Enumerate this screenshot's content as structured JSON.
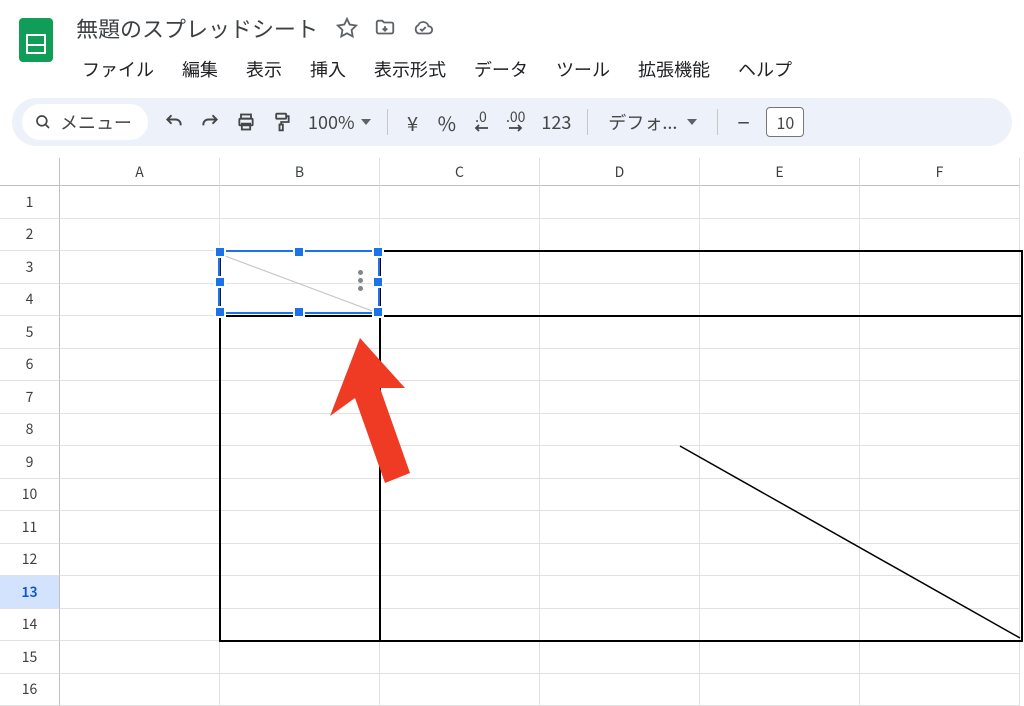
{
  "doc": {
    "title": "無題のスプレッドシート"
  },
  "menus": {
    "file": "ファイル",
    "edit": "編集",
    "view": "表示",
    "insert": "挿入",
    "format": "表示形式",
    "data": "データ",
    "tools": "ツール",
    "extensions": "拡張機能",
    "help": "ヘルプ"
  },
  "toolbar": {
    "menu_label": "メニュー",
    "zoom": "100%",
    "currency": "¥",
    "percent": "%",
    "dec_less": ".0",
    "dec_more": ".00",
    "num_fmt": "123",
    "font": "デフォ...",
    "font_size": "10"
  },
  "columns": [
    "A",
    "B",
    "C",
    "D",
    "E",
    "F"
  ],
  "rows": [
    "1",
    "2",
    "3",
    "4",
    "5",
    "6",
    "7",
    "8",
    "9",
    "10",
    "11",
    "12",
    "13",
    "14",
    "15",
    "16"
  ],
  "selected_row": "13"
}
